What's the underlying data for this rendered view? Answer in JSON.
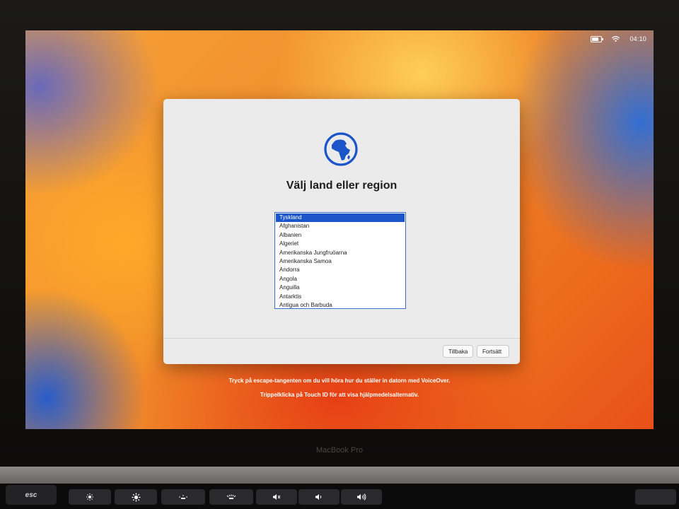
{
  "menubar": {
    "battery_icon": "battery-icon",
    "wifi_icon": "wifi-icon",
    "clock": "04:10"
  },
  "dialog": {
    "icon": "globe-icon",
    "title": "Välj land eller region",
    "countries": [
      "Tyskland",
      "Afghanistan",
      "Albanien",
      "Algeriet",
      "Amerikanska Jungfruöarna",
      "Amerikanska Samoa",
      "Andorra",
      "Angola",
      "Anguilla",
      "Antarktis",
      "Antigua och Barbuda"
    ],
    "selected_country": "Tyskland",
    "back_label": "Tillbaka",
    "continue_label": "Fortsätt"
  },
  "hints": {
    "voiceover": "Tryck på escape-tangenten om du vill höra hur du ställer in datorn med VoiceOver.",
    "accessibility": "Trippelklicka på Touch ID för att visa hjälpmedelsalternativ."
  },
  "laptop": {
    "model_label": "MacBook Pro",
    "esc_label": "esc"
  },
  "colors": {
    "accent": "#1b55c8",
    "globe": "#1b55c8"
  }
}
